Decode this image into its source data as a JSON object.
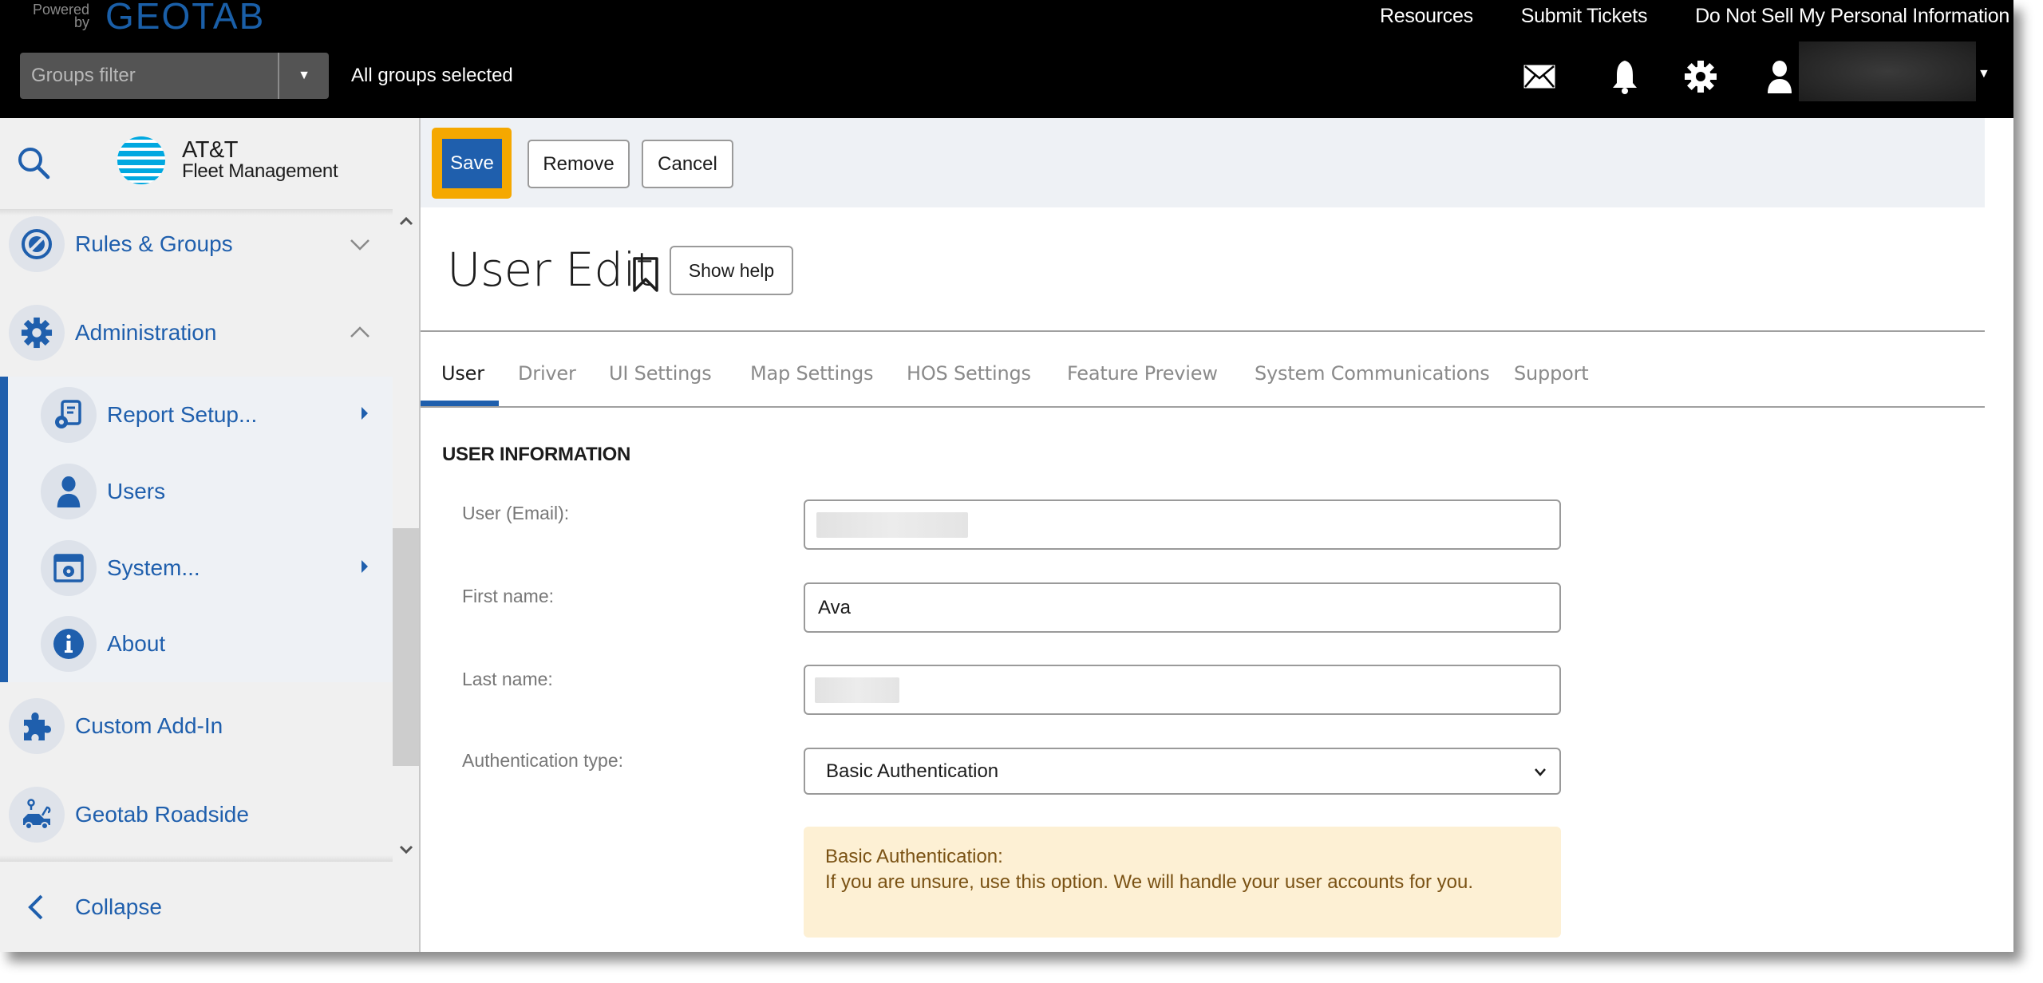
{
  "header": {
    "brand_powered": "Powered by",
    "brand_name": "GEOTAB",
    "links": [
      "Resources",
      "Submit Tickets",
      "Do Not Sell My Personal Information"
    ],
    "groups_filter": {
      "placeholder": "Groups filter",
      "status": "All groups selected"
    },
    "icons": [
      "mail-icon",
      "bell-icon",
      "gear-icon",
      "user-icon"
    ],
    "user_name": ""
  },
  "sidebar": {
    "logo_line1": "AT&T",
    "logo_line2": "Fleet Management",
    "items": [
      {
        "label": "Rules & Groups",
        "icon": "rules-icon",
        "state": "collapsed"
      },
      {
        "label": "Administration",
        "icon": "gear-icon",
        "state": "expanded"
      }
    ],
    "admin_subitems": [
      {
        "label": "Report Setup...",
        "icon": "report-setup-icon",
        "has_submenu": true
      },
      {
        "label": "Users",
        "icon": "user-icon",
        "has_submenu": false
      },
      {
        "label": "System...",
        "icon": "system-icon",
        "has_submenu": true
      },
      {
        "label": "About",
        "icon": "info-icon",
        "has_submenu": false
      }
    ],
    "bottom_items": [
      {
        "label": "Custom Add-In",
        "icon": "puzzle-icon"
      },
      {
        "label": "Geotab Roadside",
        "icon": "tow-truck-icon"
      }
    ],
    "collapse_label": "Collapse"
  },
  "toolbar": {
    "save_label": "Save",
    "remove_label": "Remove",
    "cancel_label": "Cancel"
  },
  "page": {
    "title": "User Edit",
    "show_help_label": "Show help",
    "tabs": [
      "User",
      "Driver",
      "UI Settings",
      "Map Settings",
      "HOS Settings",
      "Feature Preview",
      "System Communications",
      "Support"
    ],
    "active_tab": "User",
    "section_title": "USER INFORMATION",
    "fields": {
      "email": {
        "label": "User (Email):",
        "value": ""
      },
      "first_name": {
        "label": "First name:",
        "value": "Ava"
      },
      "last_name": {
        "label": "Last name:",
        "value": ""
      },
      "auth_type": {
        "label": "Authentication type:",
        "value": "Basic Authentication"
      }
    },
    "auth_note": {
      "title": "Basic Authentication:",
      "body": "If you are unsure, use this option. We will handle your user accounts for you."
    }
  },
  "colors": {
    "brand_blue": "#1f5fad",
    "save_highlight": "#f5a800",
    "note_bg": "#fdf0d4",
    "note_text": "#7a5214"
  }
}
